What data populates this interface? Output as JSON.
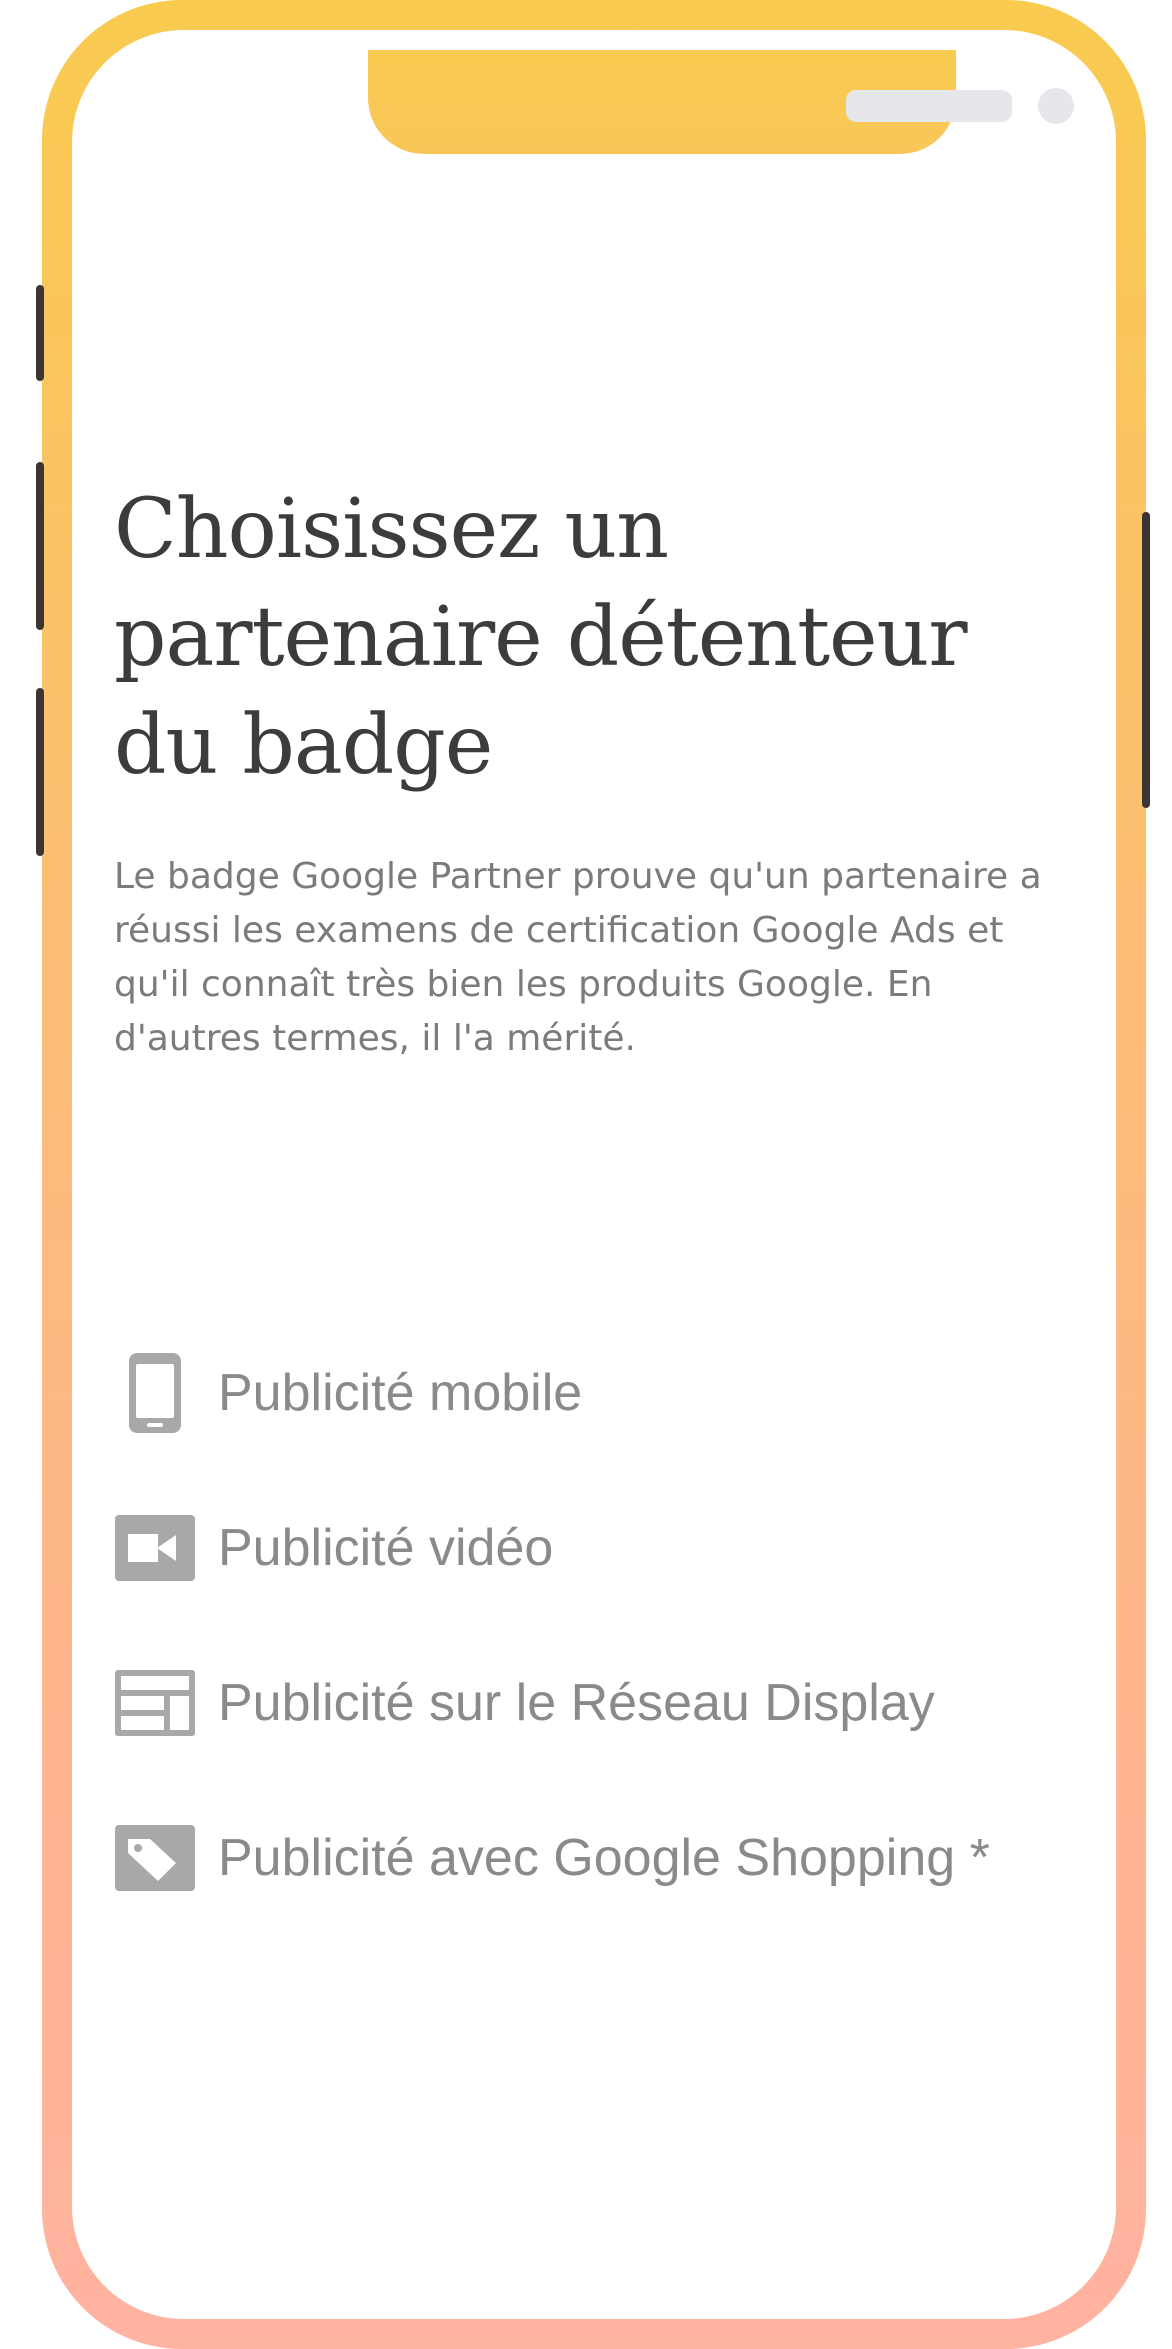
{
  "screen": {
    "title": "Choisissez un partenaire détenteur du badge",
    "description": "Le badge Google Partner prouve qu'un partenaire a réussi les examens de certification Google Ads et qu'il connaît très bien les produits Google. En d'autres termes, il l'a mérité."
  },
  "features": [
    {
      "label": "Publicité mobile",
      "icon": "mobile-phone-icon"
    },
    {
      "label": "Publicité vidéo",
      "icon": "video-camera-icon"
    },
    {
      "label": "Publicité sur le Réseau Display",
      "icon": "display-network-icon"
    },
    {
      "label": "Publicité avec Google Shopping *",
      "icon": "shopping-tag-icon"
    }
  ],
  "colors": {
    "frame_top": "#f9cb4f",
    "frame_bottom": "#ffb3a1",
    "title_text": "#3c3c3c",
    "body_text": "#7b7b7b",
    "feature_text": "#8a8a8a",
    "icon_gray": "#a8a8a8"
  }
}
